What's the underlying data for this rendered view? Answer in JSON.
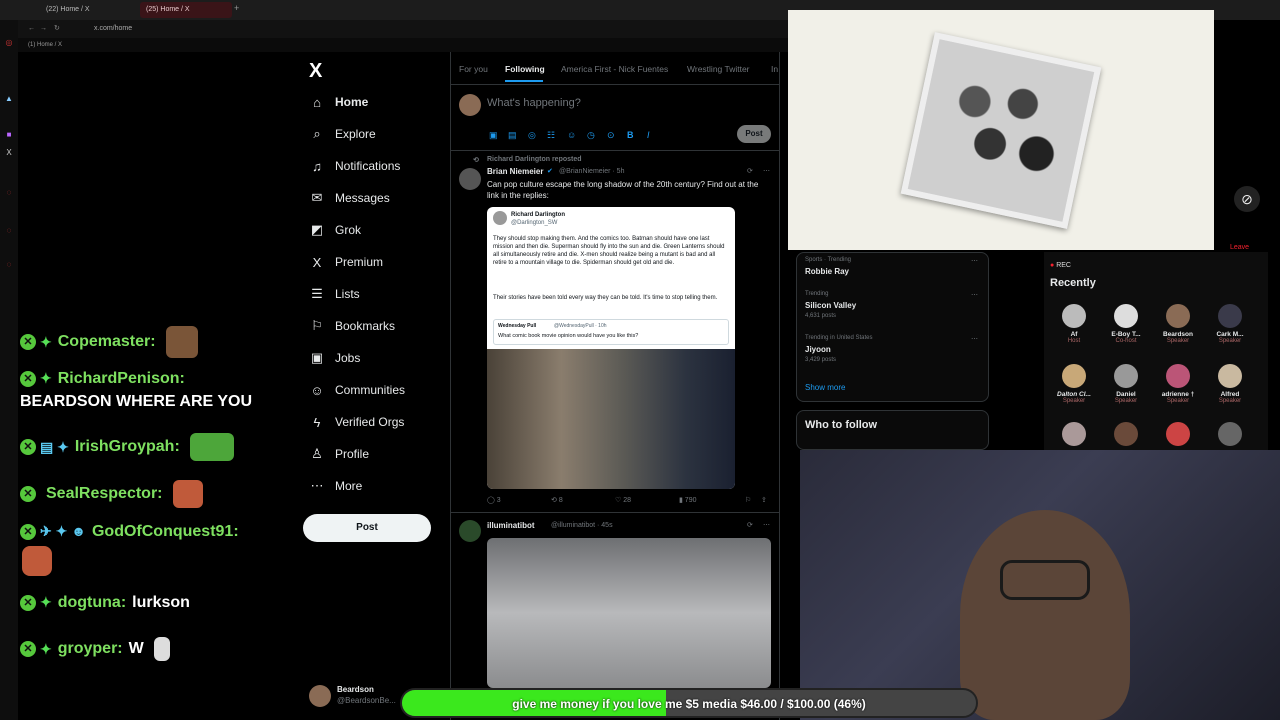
{
  "browser": {
    "tabs": [
      {
        "label": "(22) Home / X"
      },
      {
        "label": "(25) Home / X"
      }
    ],
    "url": "x.com/home",
    "bookmark": "(1) Home / X"
  },
  "chat": [
    {
      "user": "Copemaster:",
      "msg": "",
      "badges": "✦"
    },
    {
      "user": "RichardPenison:",
      "msg": "BEARDSON WHERE ARE YOU",
      "badges": "✦"
    },
    {
      "user": "IrishGroypah:",
      "msg": "",
      "badges": "▤ ✦"
    },
    {
      "user": "SealRespector:",
      "msg": "",
      "badges": ""
    },
    {
      "user": "GodOfConquest91:",
      "msg": "",
      "badges": "✈ ✦ ☻"
    },
    {
      "user": "dogtuna:",
      "msg": "lurkson",
      "badges": "✦"
    },
    {
      "user": "groyper:",
      "msg": "W",
      "badges": "✦"
    }
  ],
  "sidebar": {
    "logo": "X",
    "items": [
      {
        "label": "Home",
        "icon": "⌂"
      },
      {
        "label": "Explore",
        "icon": "⌕"
      },
      {
        "label": "Notifications",
        "icon": "♫"
      },
      {
        "label": "Messages",
        "icon": "✉"
      },
      {
        "label": "Grok",
        "icon": "◩"
      },
      {
        "label": "Premium",
        "icon": "X"
      },
      {
        "label": "Lists",
        "icon": "☰"
      },
      {
        "label": "Bookmarks",
        "icon": "⚐"
      },
      {
        "label": "Jobs",
        "icon": "▣"
      },
      {
        "label": "Communities",
        "icon": "☺"
      },
      {
        "label": "Verified Orgs",
        "icon": "ϟ"
      },
      {
        "label": "Profile",
        "icon": "♙"
      },
      {
        "label": "More",
        "icon": "⋯"
      }
    ],
    "post": "Post",
    "profile": {
      "name": "Beardson",
      "handle": "@BeardsonBe..."
    }
  },
  "feed": {
    "tabs": [
      "For you",
      "Following",
      "America First - Nick Fuentes",
      "Wrestling Twitter",
      "In"
    ],
    "compose_placeholder": "What's happening?",
    "compose_post": "Post",
    "tweet1": {
      "reposted": "Richard Darlington reposted",
      "name": "Brian Niemeier",
      "handle": "@BrianNiemeier · 5h",
      "text": "Can pop culture escape the long shadow of the 20th century? Find out at the link in the replies:",
      "quote_name": "Richard Darlington",
      "quote_handle": "@Darlington_SW",
      "quote_text1": "They should stop making them. And the comics too. Batman should have one last mission and then die. Superman should fly into the sun and die. Green Lanterns should all simultaneously retire and die. X-men should realize being a mutant is bad and all retire to a mountain village to die. Spiderman should get old and die.",
      "quote_text2": "Their stories have been told every way they can be told. It's time to stop telling them.",
      "inner_name": "Wednesday Pull",
      "inner_handle": "@WednesdayPull · 10h",
      "inner_text": "What comic book movie opinion would have you like this?",
      "replies": "3",
      "reposts": "8",
      "likes": "28",
      "views": "790"
    },
    "tweet2": {
      "name": "illuminatibot",
      "handle": "@illuminatibot · 45s"
    }
  },
  "trending": [
    {
      "cat": "Sports · Trending",
      "name": "Robbie Ray",
      "posts": ""
    },
    {
      "cat": "Trending",
      "name": "Silicon Valley",
      "posts": "4,631 posts"
    },
    {
      "cat": "Trending in United States",
      "name": "Jiyoon",
      "posts": "3,429 posts"
    }
  ],
  "show_more": "Show more",
  "who_to_follow": "Who to follow",
  "spaces": {
    "rec": "REC",
    "title": "Recently",
    "leave": "Leave",
    "people": [
      {
        "name": "Af",
        "role": "Host"
      },
      {
        "name": "E-Boy T...",
        "role": "Co-host"
      },
      {
        "name": "Beardson",
        "role": "Speaker"
      },
      {
        "name": "Cark M...",
        "role": "Speaker"
      },
      {
        "name": "Dalton Cl...",
        "role": "Speaker"
      },
      {
        "name": "Daniel",
        "role": "Speaker"
      },
      {
        "name": "adrienne †",
        "role": "Speaker"
      },
      {
        "name": "Alfred",
        "role": "Speaker"
      }
    ]
  },
  "donation": {
    "text": "give me money if you love me $5 media $46.00 / $100.00 (46%)",
    "progress": 0.46
  },
  "colors": {
    "accent": "#1d9bf0",
    "chat_green": "#7ee060",
    "donation_fill": "#3be81d"
  }
}
